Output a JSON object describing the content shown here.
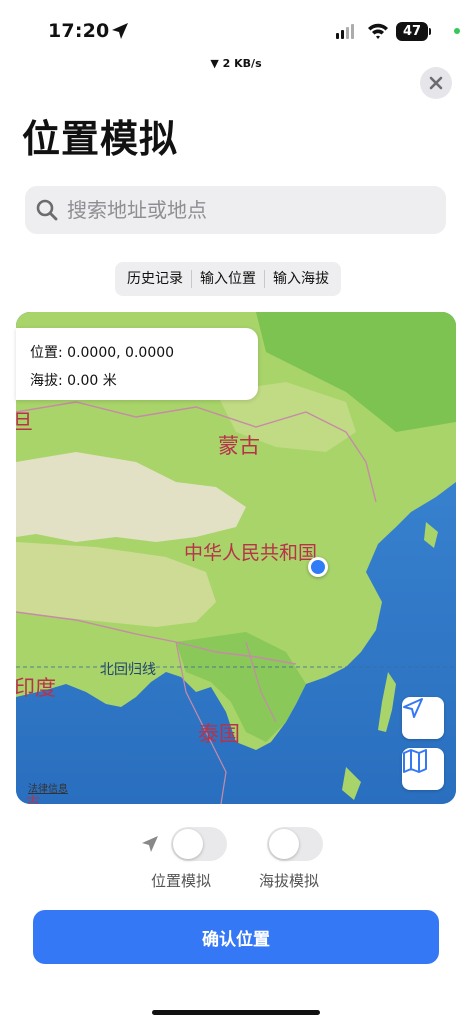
{
  "status_bar": {
    "time": "17:20",
    "battery": "47",
    "net_speed": "▼ 2 KB/s"
  },
  "page": {
    "title": "位置模拟"
  },
  "search": {
    "placeholder": "搜索地址或地点"
  },
  "segments": [
    "历史记录",
    "输入位置",
    "输入海拔"
  ],
  "info": {
    "position_label": "位置:",
    "position_value": "0.0000, 0.0000",
    "altitude_label": "海拔:",
    "altitude_value": "0.00 米"
  },
  "map": {
    "labels": {
      "mongolia": "蒙古",
      "china": "中华人民共和国",
      "tropic": "北回归线",
      "india": "印度",
      "thailand": "泰国",
      "edge_left": "旦",
      "legal": "法律信息",
      "edge_bottom": "古"
    },
    "user_dot_color": "#2f7cf6"
  },
  "toggles": {
    "location_label": "位置模拟",
    "altitude_label": "海拔模拟",
    "location_on": false,
    "altitude_on": false
  },
  "confirm_label": "确认位置",
  "icons": [
    "location-arrow-icon",
    "signal-icon",
    "wifi-icon",
    "battery-icon",
    "close-icon",
    "search-icon",
    "navigation-icon",
    "map-icon"
  ]
}
